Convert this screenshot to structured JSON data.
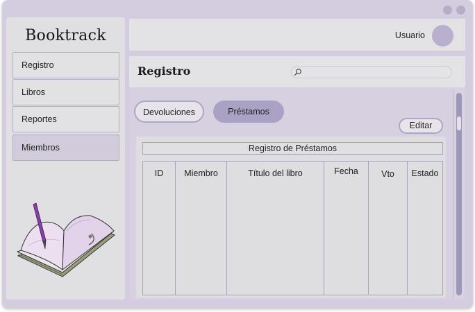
{
  "app": {
    "brand": "Booktrack"
  },
  "sidebar": {
    "items": [
      {
        "label": "Registro",
        "active": false
      },
      {
        "label": "Libros",
        "active": false
      },
      {
        "label": "Reportes",
        "active": false
      },
      {
        "label": "Miembros",
        "active": true
      }
    ]
  },
  "header": {
    "user_label": "Usuario"
  },
  "page": {
    "title": "Registro"
  },
  "search": {
    "placeholder": "",
    "value": ""
  },
  "toolbar": {
    "devoluciones_label": "Devoluciones",
    "prestamos_label": "Préstamos",
    "edit_label": "Editar"
  },
  "table": {
    "title": "Registro de Préstamos",
    "columns": [
      "ID",
      "Miembro",
      "Título del libro",
      "Fecha",
      "Vto",
      "Estado"
    ],
    "rows": []
  },
  "colors": {
    "accent": "#aaa2c5",
    "window_bg": "#d4cde0",
    "panel_bg": "#e3e2e4",
    "active_nav": "#d1cbdc"
  }
}
